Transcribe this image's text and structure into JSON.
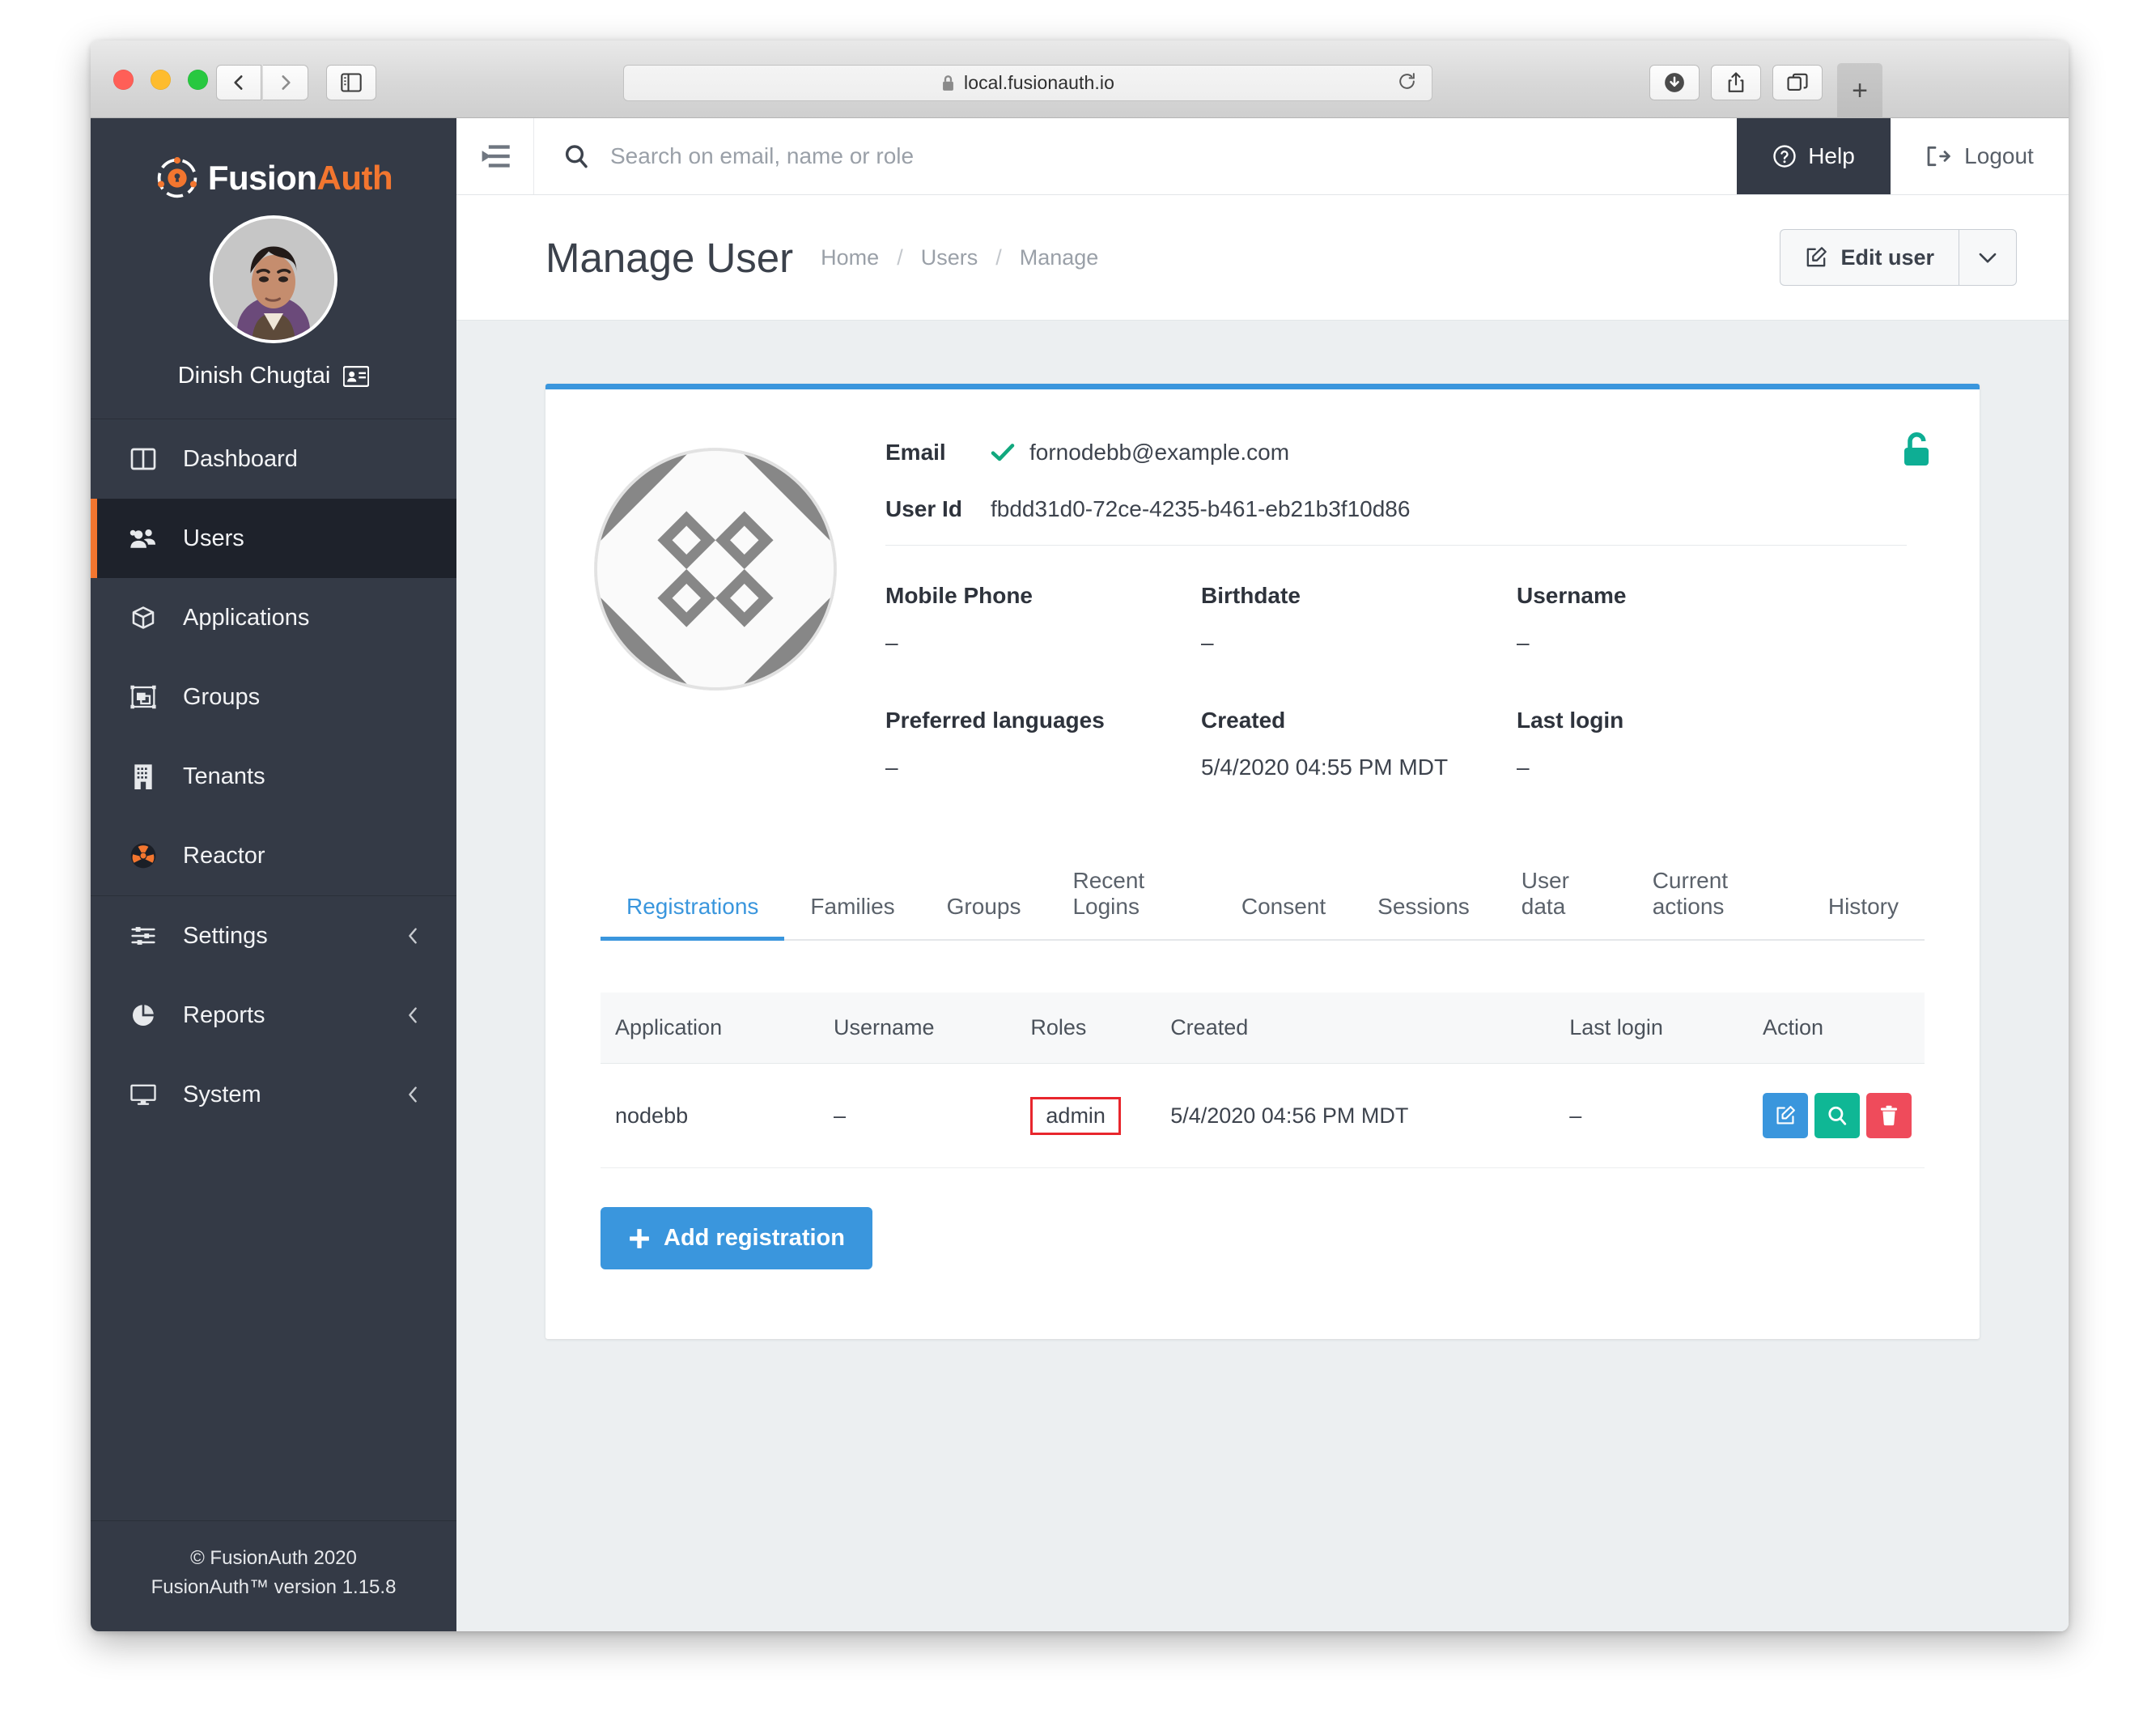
{
  "browser": {
    "url": "local.fusionauth.io",
    "lock_icon": "lock-icon",
    "reload_icon": "reload-icon",
    "back_icon": "chevron-left-icon",
    "forward_icon": "chevron-right-icon",
    "sidebar_icon": "sidebar-panel-icon",
    "download_icon": "download-icon",
    "share_icon": "share-icon",
    "tabs_icon": "tab-overview-icon",
    "newtab_label": "+"
  },
  "sidebar": {
    "brand": {
      "first": "Fusion",
      "second": "Auth"
    },
    "profile": {
      "name": "Dinish Chugtai",
      "badge_icon": "id-card-icon"
    },
    "items": [
      {
        "label": "Dashboard",
        "icon": "dashboard-icon",
        "active": false
      },
      {
        "label": "Users",
        "icon": "users-icon",
        "active": true
      },
      {
        "label": "Applications",
        "icon": "cube-icon",
        "active": false
      },
      {
        "label": "Groups",
        "icon": "groups-icon",
        "active": false
      },
      {
        "label": "Tenants",
        "icon": "building-icon",
        "active": false
      },
      {
        "label": "Reactor",
        "icon": "reactor-icon",
        "active": false
      }
    ],
    "items_lower": [
      {
        "label": "Settings",
        "icon": "sliders-icon",
        "chevron": "chevron-left-icon"
      },
      {
        "label": "Reports",
        "icon": "pie-chart-icon",
        "chevron": "chevron-left-icon"
      },
      {
        "label": "System",
        "icon": "monitor-icon",
        "chevron": "chevron-left-icon"
      }
    ],
    "footer": {
      "copyright": "© FusionAuth 2020",
      "version": "FusionAuth™ version 1.15.8"
    }
  },
  "topbar": {
    "hamburger_icon": "collapse-menu-icon",
    "search": {
      "placeholder": "Search on email, name or role",
      "value": ""
    },
    "help_label": "Help",
    "help_icon": "question-circle-icon",
    "logout_label": "Logout",
    "logout_icon": "logout-icon"
  },
  "pagehead": {
    "title": "Manage User",
    "breadcrumb": [
      "Home",
      "Users",
      "Manage"
    ],
    "separator": "/",
    "edit_user_label": "Edit user",
    "edit_user_icon": "pencil-square-icon",
    "caret_icon": "chevron-down-icon"
  },
  "user_card": {
    "unlock_icon": "unlock-icon",
    "unlock_color": "#0eae94",
    "gravatar_icon": "identicon-placeholder",
    "email_label": "Email",
    "email_value": "fornodebb@example.com",
    "email_verified_icon": "check-icon",
    "email_verified_color": "#12a87e",
    "userid_label": "User Id",
    "userid_value": "fbdd31d0-72ce-4235-b461-eb21b3f10d86",
    "fields": [
      {
        "label": "Mobile Phone",
        "value": "–"
      },
      {
        "label": "Birthdate",
        "value": "–"
      },
      {
        "label": "Username",
        "value": "–"
      },
      {
        "label": "Preferred languages",
        "value": "–"
      },
      {
        "label": "Created",
        "value": "5/4/2020 04:55 PM MDT"
      },
      {
        "label": "Last login",
        "value": "–"
      }
    ]
  },
  "tabs": [
    {
      "label": "Registrations",
      "active": true
    },
    {
      "label": "Families",
      "active": false
    },
    {
      "label": "Groups",
      "active": false
    },
    {
      "label": "Recent Logins",
      "active": false
    },
    {
      "label": "Consent",
      "active": false
    },
    {
      "label": "Sessions",
      "active": false
    },
    {
      "label": "User data",
      "active": false
    },
    {
      "label": "Current actions",
      "active": false
    },
    {
      "label": "History",
      "active": false
    }
  ],
  "registrations_table": {
    "headers": [
      "Application",
      "Username",
      "Roles",
      "Created",
      "Last login",
      "Action"
    ],
    "rows": [
      {
        "application": "nodebb",
        "username": "–",
        "roles": "admin",
        "roles_highlight_color": "#e8262d",
        "created": "5/4/2020 04:56 PM MDT",
        "last_login": "–",
        "actions": [
          {
            "icon": "edit-icon",
            "color": "#3a96dd"
          },
          {
            "icon": "search-icon",
            "color": "#0fb795"
          },
          {
            "icon": "trash-icon",
            "color": "#ef4b5b"
          }
        ]
      }
    ]
  },
  "add_registration": {
    "label": "Add registration",
    "icon": "plus-icon",
    "color": "#3a96dd"
  }
}
